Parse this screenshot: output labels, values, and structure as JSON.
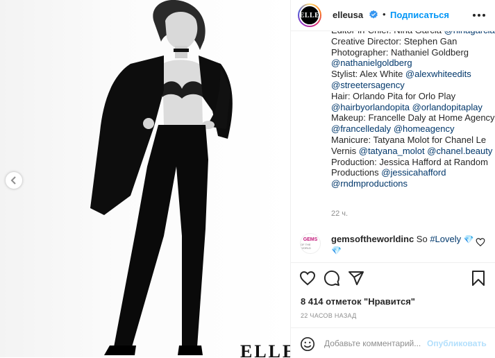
{
  "photo": {
    "watermark": "ELLE",
    "prev_icon": "chevron-left-icon"
  },
  "header": {
    "avatar_text": "ELLE",
    "username": "elleusa",
    "verified_icon": "verified-badge-icon",
    "separator": "•",
    "follow_label": "Подписаться",
    "more_icon": "more-horizontal-icon"
  },
  "caption": {
    "lines": [
      [
        {
          "t": "Editor-in-Chief: Nina Garcia "
        },
        {
          "t": "@ninagarcia",
          "m": true
        }
      ],
      [
        {
          "t": "Creative Director: Stephen Gan"
        }
      ],
      [
        {
          "t": "Photographer: Nathaniel Goldberg"
        }
      ],
      [
        {
          "t": "@nathanielgoldberg",
          "m": true
        }
      ],
      [
        {
          "t": "Stylist: Alex White "
        },
        {
          "t": "@alexwhiteedits",
          "m": true
        }
      ],
      [
        {
          "t": "@streetersagency",
          "m": true
        }
      ],
      [
        {
          "t": "Hair: Orlando Pita for Orlo Play"
        }
      ],
      [
        {
          "t": "@hairbyorlandopita",
          "m": true
        },
        {
          "t": " "
        },
        {
          "t": "@orlandopitaplay",
          "m": true
        }
      ],
      [
        {
          "t": "Makeup: Francelle Daly at Home Agency"
        }
      ],
      [
        {
          "t": "@francelledaly",
          "m": true
        },
        {
          "t": " "
        },
        {
          "t": "@homeagency",
          "m": true
        }
      ],
      [
        {
          "t": "Manicure: Tatyana Molot for Chanel Le"
        }
      ],
      [
        {
          "t": "Vernis "
        },
        {
          "t": "@tatyana_molot",
          "m": true
        },
        {
          "t": " "
        },
        {
          "t": "@chanel.beauty",
          "m": true
        }
      ],
      [
        {
          "t": "Production: Jessica Hafford at Random"
        }
      ],
      [
        {
          "t": "Productions "
        },
        {
          "t": "@jessicahafford",
          "m": true
        }
      ],
      [
        {
          "t": "@rndmproductions",
          "m": true
        }
      ]
    ],
    "time": "22 ч."
  },
  "comment": {
    "avatar_line1": "GEMS",
    "avatar_line2": "OF THE WORLD",
    "user": "gemsoftheworldinc",
    "text": " So ",
    "hashtag": "#Lovely",
    "gem1": "💎",
    "gem2": "💎",
    "like_icon": "heart-outline-icon"
  },
  "actions": {
    "like_icon": "heart-icon",
    "comment_icon": "comment-icon",
    "share_icon": "share-icon",
    "save_icon": "bookmark-icon",
    "likes": "8 414 отметок \"Нравится\"",
    "time_ago": "22 ЧАСОВ НАЗАД"
  },
  "add_comment": {
    "emoji_icon": "smiley-icon",
    "placeholder": "Добавьте комментарий...",
    "publish_label": "Опубликовать"
  },
  "colors": {
    "link_blue": "#0095f6",
    "mention": "#00376b",
    "muted": "#8e8e8e",
    "publish_disabled": "#b2dffc"
  }
}
